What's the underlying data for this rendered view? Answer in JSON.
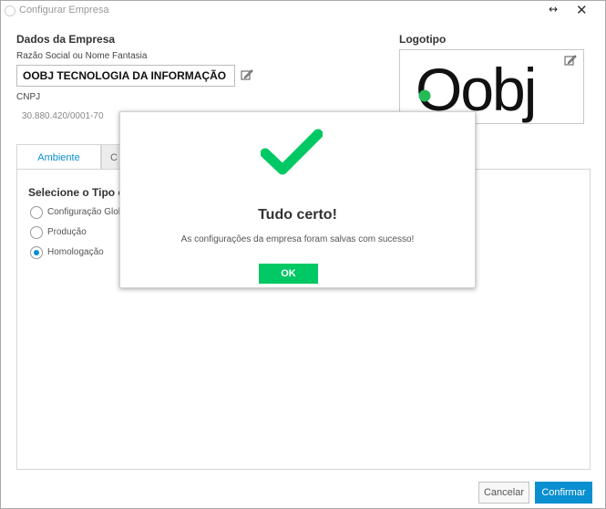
{
  "window": {
    "title": "Configurar Empresa",
    "resize_glyph": "↔",
    "close_glyph": "✕"
  },
  "company": {
    "section_title": "Dados da Empresa",
    "name_label": "Razão Social ou Nome Fantasia",
    "name_value": "OOBJ TECNOLOGIA DA INFORMAÇÃO",
    "cnpj_label": "CNPJ",
    "cnpj_value": "30.880.420/0001-70"
  },
  "logo": {
    "section_title": "Logotipo",
    "logo_text": "Oobj"
  },
  "tabs": [
    {
      "label": "Ambiente",
      "active": true
    },
    {
      "label": "C",
      "active": false
    }
  ],
  "ambiente": {
    "title": "Selecione o Tipo de",
    "options": [
      {
        "label": "Configuração Glob",
        "checked": false
      },
      {
        "label": "Produção",
        "checked": false
      },
      {
        "label": "Homologação",
        "checked": true
      }
    ]
  },
  "footer": {
    "cancel_label": "Cancelar",
    "confirm_label": "Confirmar"
  },
  "modal": {
    "title": "Tudo certo!",
    "message": "As configurações da empresa foram salvas com sucesso!",
    "ok_label": "OK"
  },
  "colors": {
    "accent": "#0a8fd1",
    "success": "#00c864",
    "logo_dot": "#22bb55"
  },
  "icons": [
    "pencil-edit-icon",
    "checkmark-icon",
    "resize-icon",
    "close-icon",
    "app-icon"
  ]
}
